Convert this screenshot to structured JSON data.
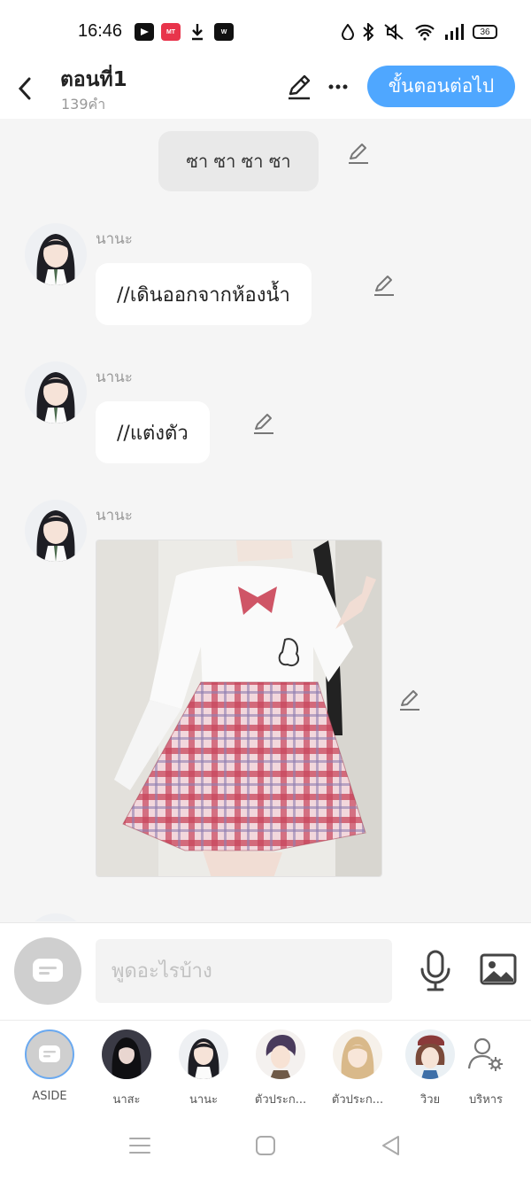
{
  "status": {
    "time": "16:46",
    "battery": "36",
    "apps": [
      {
        "name": "youtube-icon",
        "label": "▶",
        "color": "#111111"
      },
      {
        "name": "mangatoon-icon",
        "label": "MANGA TOON",
        "color": "#e8344b"
      },
      {
        "name": "download-icon",
        "label": "⤓",
        "color": "#111111"
      },
      {
        "name": "webtoon-icon",
        "label": "WEB TOON",
        "color": "#111111"
      }
    ]
  },
  "header": {
    "title": "ตอนที่1",
    "word_count": "139คำ",
    "next_label": "ขั้นตอนต่อไป"
  },
  "chat": {
    "narration": "ซา ซา ซา ซา",
    "messages": [
      {
        "sender": "นานะ",
        "text": "//เดินออกจากห้องน้ำ"
      },
      {
        "sender": "นานะ",
        "text": "//แต่งตัว"
      },
      {
        "sender": "นานะ",
        "type": "image"
      }
    ]
  },
  "input": {
    "placeholder": "พูดอะไรบ้าง"
  },
  "characters": [
    {
      "label": "ASIDE"
    },
    {
      "label": "นาสะ"
    },
    {
      "label": "นานะ"
    },
    {
      "label": "ตัวประก..."
    },
    {
      "label": "ตัวประก..."
    },
    {
      "label": "วิวย"
    },
    {
      "label": "บริหาร"
    }
  ],
  "colors": {
    "accent": "#4fa7ff",
    "background": "#f5f5f5"
  }
}
